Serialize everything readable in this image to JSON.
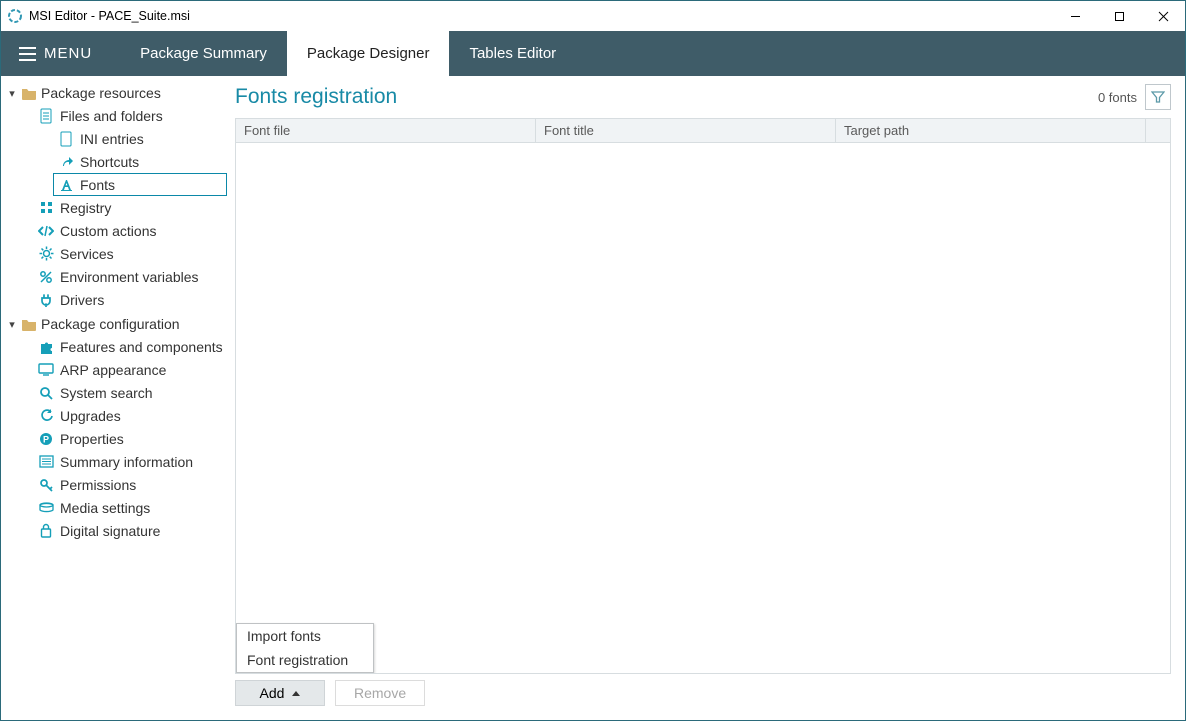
{
  "title": "MSI Editor - PACE_Suite.msi",
  "toolbar": {
    "menu": "MENU",
    "tabs": [
      "Package Summary",
      "Package Designer",
      "Tables Editor"
    ],
    "active_tab": 1
  },
  "sidebar": {
    "sections": [
      {
        "label": "Package resources",
        "items": [
          {
            "label": "Files and folders",
            "icon": "doc-icon",
            "children": [
              {
                "label": "INI entries",
                "icon": "ini-icon"
              },
              {
                "label": "Shortcuts",
                "icon": "shortcut-icon"
              },
              {
                "label": "Fonts",
                "icon": "font-icon",
                "selected": true
              }
            ]
          },
          {
            "label": "Registry",
            "icon": "registry-icon"
          },
          {
            "label": "Custom actions",
            "icon": "code-icon"
          },
          {
            "label": "Services",
            "icon": "gear-icon"
          },
          {
            "label": "Environment variables",
            "icon": "percent-icon"
          },
          {
            "label": "Drivers",
            "icon": "plug-icon"
          }
        ]
      },
      {
        "label": "Package configuration",
        "items": [
          {
            "label": "Features and components",
            "icon": "puzzle-icon"
          },
          {
            "label": "ARP appearance",
            "icon": "monitor-icon"
          },
          {
            "label": "System search",
            "icon": "search-icon"
          },
          {
            "label": "Upgrades",
            "icon": "refresh-icon"
          },
          {
            "label": "Properties",
            "icon": "p-icon"
          },
          {
            "label": "Summary information",
            "icon": "list-icon"
          },
          {
            "label": "Permissions",
            "icon": "key-icon"
          },
          {
            "label": "Media settings",
            "icon": "media-icon"
          },
          {
            "label": "Digital signature",
            "icon": "lock-icon"
          }
        ]
      }
    ]
  },
  "main": {
    "title": "Fonts registration",
    "count_label": "0 fonts",
    "columns": [
      "Font file",
      "Font title",
      "Target path"
    ],
    "rows": [],
    "popup": {
      "items": [
        "Import fonts",
        "Font registration"
      ],
      "visible": true
    },
    "buttons": {
      "add": "Add",
      "remove": "Remove"
    }
  }
}
